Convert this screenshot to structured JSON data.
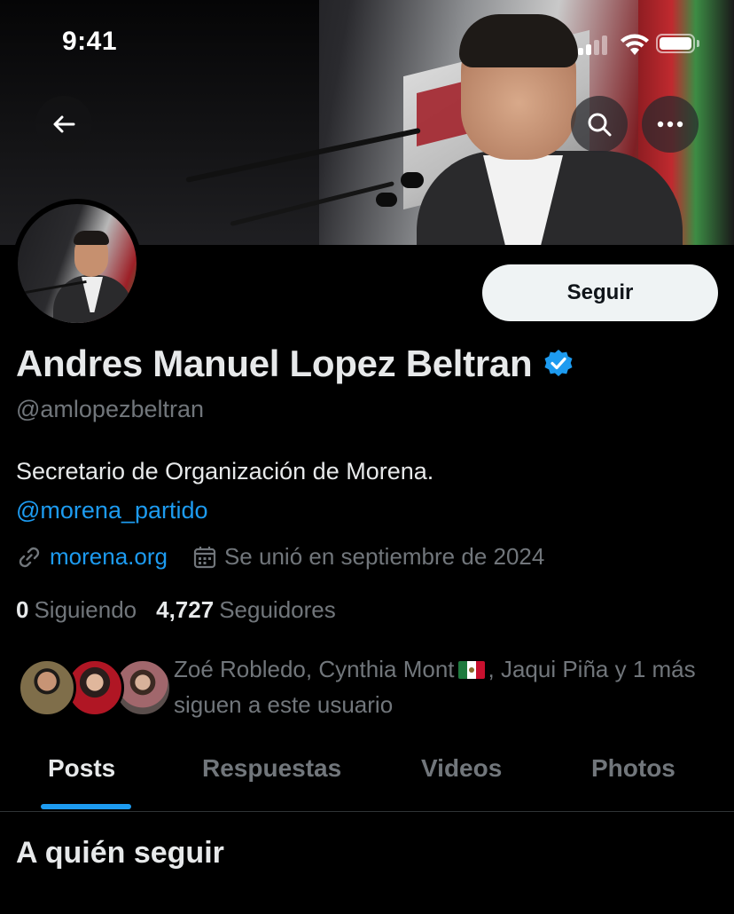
{
  "status_bar": {
    "time": "9:41"
  },
  "profile": {
    "name": "Andres Manuel Lopez Beltran",
    "handle": "@amlopezbeltran",
    "bio": "Secretario de Organización de Morena.",
    "bio_mention": "@morena_partido",
    "website": "morena.org",
    "joined": "Se unió en septiembre de 2024",
    "following_count": "0",
    "following_label": "Siguiendo",
    "followers_count": "4,727",
    "followers_label": "Seguidores",
    "verified": true
  },
  "actions": {
    "follow_label": "Seguir"
  },
  "mutuals": {
    "text_before_flag": "Zoé Robledo, Cynthia Mont",
    "text_after_flag": ", Jaqui Piña y 1 más siguen a este usuario"
  },
  "tabs": [
    {
      "label": "Posts",
      "active": true
    },
    {
      "label": "Respuestas",
      "active": false
    },
    {
      "label": "Videos",
      "active": false
    },
    {
      "label": "Photos",
      "active": false
    }
  ],
  "section": {
    "title": "A quién seguir"
  },
  "colors": {
    "accent": "#1d9bf0",
    "background": "#000000",
    "secondary_text": "#71767b"
  },
  "icons": [
    "back-arrow-icon",
    "search-icon",
    "more-icon",
    "verified-badge-icon",
    "link-icon",
    "calendar-icon",
    "mexico-flag-icon"
  ]
}
